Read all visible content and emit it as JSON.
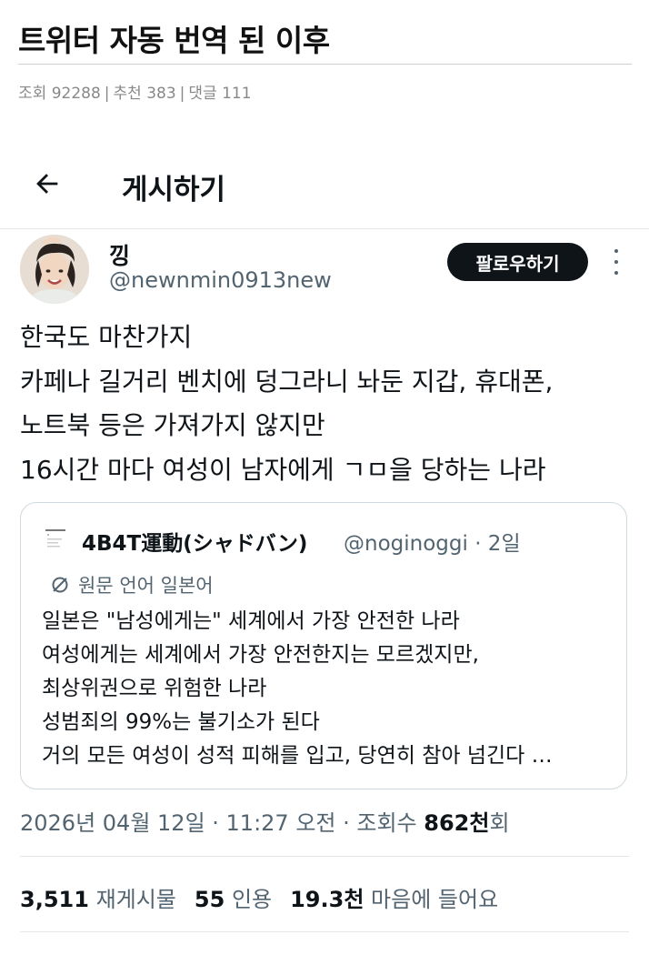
{
  "post": {
    "title": "트위터 자동 번역 된 이후",
    "views_label": "조회",
    "views": "92288",
    "recommend_label": "추천",
    "recommend": "383",
    "comments_label": "댓글",
    "comments": "111"
  },
  "header": {
    "title": "게시하기"
  },
  "tweet": {
    "display_name": "낑",
    "handle": "@newnmin0913new",
    "follow_label": "팔로우하기",
    "lines": [
      "한국도 마찬가지",
      "카페나 길거리 벤치에 덩그라니 놔둔 지갑, 휴대폰,",
      "노트북 등은 가져가지 않지만",
      "16시간 마다 여성이 남자에게 ㄱㅁ을 당하는 나라"
    ],
    "timestamp_prefix": "2026년 04월 12일 · 11:27 오전 · 조회수",
    "views_count": "862천",
    "views_suffix": "회",
    "stats": {
      "retweets_value": "3,511",
      "retweets_label": "재게시물",
      "quotes_value": "55",
      "quotes_label": "인용",
      "likes_value": "19.3천",
      "likes_label": "마음에 들어요"
    }
  },
  "quote": {
    "display_name": "4B4T運動(シャドバン)",
    "handle_time": "@noginoggi · 2일",
    "translate_label": "원문 언어 일본어",
    "lines": [
      "일본은 \"남성에게는\" 세계에서 가장 안전한 나라",
      "여성에게는 세계에서 가장 안전한지는 모르겠지만,",
      "최상위권으로 위험한 나라",
      "성범죄의 99%는 불기소가 된다",
      "거의 모든 여성이 성적 피해를 입고, 당연히 참아 넘긴다  …"
    ]
  },
  "colors": {
    "text": "#0f1419",
    "secondary": "#536471",
    "follow_bg": "#0f1419",
    "border": "#cfd9de"
  },
  "icons": {
    "back": "back-arrow-icon",
    "more": "more-vertical-icon",
    "translate": "translate-icon"
  }
}
